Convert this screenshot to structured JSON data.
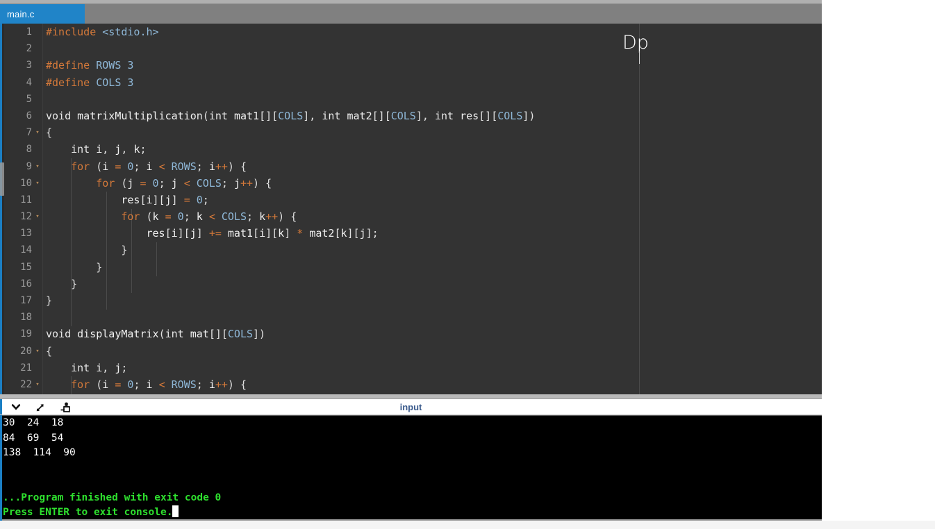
{
  "window": {
    "tab_label": "main.c",
    "cursor_artifact": "Dp"
  },
  "editor": {
    "language": "c",
    "first_visible_line": 1,
    "last_visible_line": 22,
    "lines": [
      {
        "num": "1",
        "fold": "",
        "text": "#include <stdio.h>"
      },
      {
        "num": "2",
        "fold": "",
        "text": ""
      },
      {
        "num": "3",
        "fold": "",
        "text": "#define ROWS 3"
      },
      {
        "num": "4",
        "fold": "",
        "text": "#define COLS 3"
      },
      {
        "num": "5",
        "fold": "",
        "text": ""
      },
      {
        "num": "6",
        "fold": "",
        "text": "void matrixMultiplication(int mat1[][COLS], int mat2[][COLS], int res[][COLS])"
      },
      {
        "num": "7",
        "fold": "▾",
        "text": "{"
      },
      {
        "num": "8",
        "fold": "",
        "text": "    int i, j, k;"
      },
      {
        "num": "9",
        "fold": "▾",
        "text": "    for (i = 0; i < ROWS; i++) {"
      },
      {
        "num": "10",
        "fold": "▾",
        "text": "        for (j = 0; j < COLS; j++) {"
      },
      {
        "num": "11",
        "fold": "",
        "text": "            res[i][j] = 0;"
      },
      {
        "num": "12",
        "fold": "▾",
        "text": "            for (k = 0; k < COLS; k++) {"
      },
      {
        "num": "13",
        "fold": "",
        "text": "                res[i][j] += mat1[i][k] * mat2[k][j];"
      },
      {
        "num": "14",
        "fold": "",
        "text": "            }"
      },
      {
        "num": "15",
        "fold": "",
        "text": "        }"
      },
      {
        "num": "16",
        "fold": "",
        "text": "    }"
      },
      {
        "num": "17",
        "fold": "",
        "text": "}"
      },
      {
        "num": "18",
        "fold": "",
        "text": ""
      },
      {
        "num": "19",
        "fold": "",
        "text": "void displayMatrix(int mat[][COLS])"
      },
      {
        "num": "20",
        "fold": "▾",
        "text": "{"
      },
      {
        "num": "21",
        "fold": "",
        "text": "    int i, j;"
      },
      {
        "num": "22",
        "fold": "▾",
        "text": "    for (i = 0; i < ROWS; i++) {"
      }
    ]
  },
  "console_toolbar": {
    "title": "input",
    "icons": [
      {
        "name": "chevron-down-icon"
      },
      {
        "name": "expand-diagonal-icon"
      },
      {
        "name": "import-input-icon"
      }
    ]
  },
  "console": {
    "lines": [
      {
        "text": "30  24  18",
        "style": "output"
      },
      {
        "text": "84  69  54",
        "style": "output"
      },
      {
        "text": "138  114  90",
        "style": "output"
      },
      {
        "text": "",
        "style": "output"
      },
      {
        "text": "",
        "style": "output"
      },
      {
        "text": "...Program finished with exit code 0",
        "style": "status"
      },
      {
        "text": "Press ENTER to exit console.",
        "style": "status",
        "cursor": true
      }
    ]
  },
  "colors": {
    "tab_active": "#2084c8",
    "editor_bg": "#333333",
    "gutter_bg": "#313131",
    "keyword": "#d4793a",
    "constant": "#8fb8d8",
    "identifier": "#f0f0f0",
    "console_bg": "#000000",
    "console_status": "#2ee02e",
    "accent": "#1b7fc4"
  }
}
